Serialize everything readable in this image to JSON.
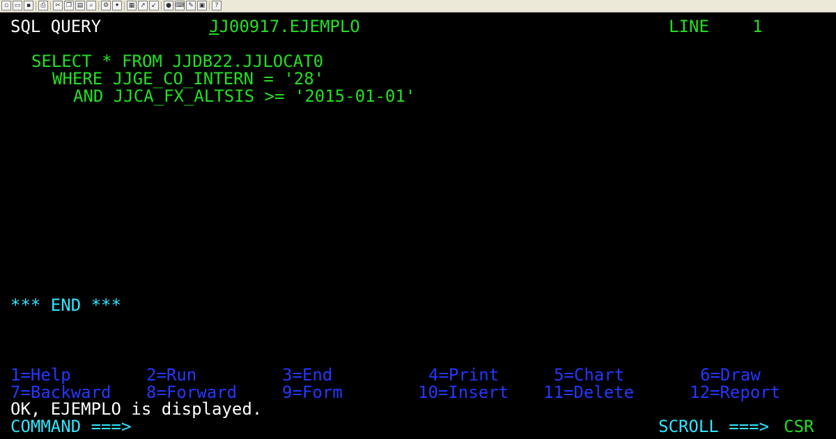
{
  "toolbar": {
    "icons": [
      "new-icon",
      "open-icon",
      "save-icon",
      "print-icon",
      "cut-icon",
      "copy-icon",
      "paste-icon",
      "find-icon",
      "settings-icon",
      "tools-icon",
      "macro-icon",
      "send-icon",
      "receive-icon",
      "color-icon",
      "keyboard-icon",
      "edit-icon",
      "display-icon",
      "help-icon"
    ]
  },
  "header": {
    "panel": "SQL QUERY",
    "query_name_first": "J",
    "query_name_rest": "J00917.EJEMPLO",
    "line_label": "LINE",
    "line_number": "1"
  },
  "query": {
    "lines": [
      "SELECT * FROM JJDB22.JJLOCAT0",
      "WHERE JJGE_CO_INTERN = '28'",
      "AND JJCA_FX_ALTSIS >= '2015-01-01'"
    ]
  },
  "end_marker": "*** END ***",
  "pf_keys": {
    "row1": [
      "1=Help",
      "2=Run",
      "3=End",
      "4=Print",
      "5=Chart",
      "6=Draw"
    ],
    "row2": [
      "7=Backward",
      "8=Forward",
      "9=Form",
      "10=Insert",
      "11=Delete",
      "12=Report"
    ]
  },
  "message": "OK, EJEMPLO is displayed.",
  "command": {
    "label": "COMMAND ===>",
    "value": ""
  },
  "scroll": {
    "label": "SCROLL ===>",
    "value": "CSR"
  },
  "colors": {
    "background": "#000000",
    "field": "#22e022",
    "protected": "#2ee6ff",
    "pfkey": "#2438ff",
    "message": "#ffffff"
  }
}
